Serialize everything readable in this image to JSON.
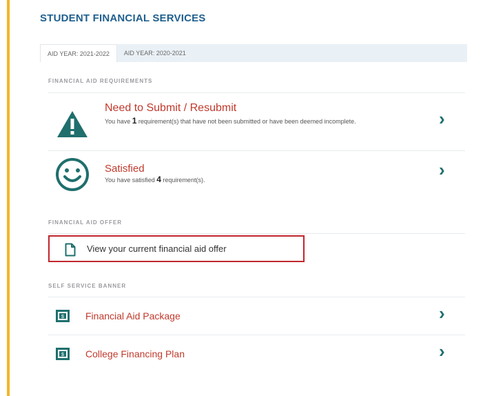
{
  "title": "STUDENT FINANCIAL SERVICES",
  "tabs": [
    {
      "label": "AID YEAR: 2021-2022",
      "active": true
    },
    {
      "label": "AID YEAR: 2020-2021",
      "active": false
    }
  ],
  "requirements": {
    "heading": "FINANCIAL AID REQUIREMENTS",
    "items": [
      {
        "title": "Need to Submit / Resubmit",
        "desc_pre": "You have ",
        "count": "1",
        "desc_post": " requirement(s) that have not been submitted or have been deemed incomplete.",
        "icon": "warning-triangle-icon"
      },
      {
        "title": "Satisfied",
        "desc_pre": "You have satisfied ",
        "count": "4",
        "desc_post": " requirement(s).",
        "icon": "smiley-icon"
      }
    ]
  },
  "offer": {
    "heading": "FINANCIAL AID OFFER",
    "link": "View your current financial aid offer",
    "icon": "document-icon",
    "highlight_color": "#c0262d"
  },
  "banner": {
    "heading": "SELF SERVICE BANNER",
    "items": [
      {
        "label": "Financial Aid Package",
        "icon": "money-icon"
      },
      {
        "label": "College Financing Plan",
        "icon": "money-icon"
      }
    ]
  },
  "colors": {
    "accent": "#1f6f6d",
    "link_red": "#c0392b",
    "title_blue": "#1f5f8e",
    "gold": "#f3b62a"
  }
}
